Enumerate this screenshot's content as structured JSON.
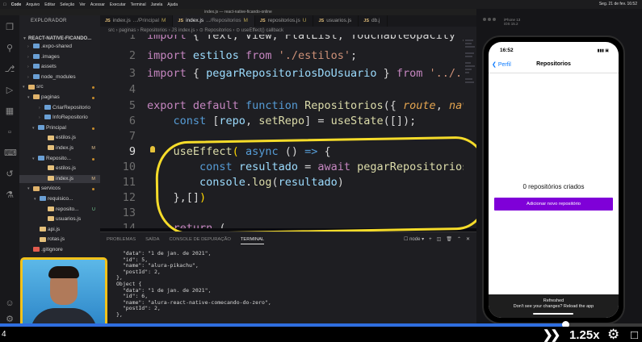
{
  "menubar": {
    "items": [
      "Code",
      "Arquivo",
      "Editar",
      "Seleção",
      "Ver",
      "Acessar",
      "Executar",
      "Terminal",
      "Janela",
      "Ajuda"
    ],
    "clock": "Seg. 21 de fev. 16:52"
  },
  "window_title": "index.js — react-native-ficando-online",
  "explorer": {
    "header": "EXPLORADOR",
    "project": "REACT-NATIVE-FICANDO...",
    "rows": [
      {
        "label": ".expo-shared",
        "badge": ""
      },
      {
        "label": ".images",
        "badge": ""
      },
      {
        "label": "assets",
        "badge": ""
      },
      {
        "label": "node_modules",
        "badge": ""
      },
      {
        "label": "src",
        "badge": ""
      },
      {
        "label": "paginas",
        "badge": ""
      },
      {
        "label": "CriarRepositorio",
        "badge": ""
      },
      {
        "label": "InfoRepositorio",
        "badge": ""
      },
      {
        "label": "Principal",
        "badge": ""
      },
      {
        "label": "estilos.js",
        "badge": ""
      },
      {
        "label": "index.js",
        "badge": "M"
      },
      {
        "label": "Reposito...",
        "badge": ""
      },
      {
        "label": "estilos.js",
        "badge": ""
      },
      {
        "label": "index.js",
        "badge": "M"
      },
      {
        "label": "servicos",
        "badge": ""
      },
      {
        "label": "requisico...",
        "badge": ""
      },
      {
        "label": "reposito...",
        "badge": "U"
      },
      {
        "label": "usuarios.js",
        "badge": ""
      },
      {
        "label": "api.js",
        "badge": ""
      },
      {
        "label": "rotas.js",
        "badge": ""
      },
      {
        "label": ".gitignore",
        "badge": ""
      }
    ]
  },
  "tabs": [
    {
      "label": "index.js",
      "hint": ".../Principal",
      "mod": "M",
      "active": false
    },
    {
      "label": "index.js",
      "hint": ".../Repositorios",
      "mod": "M",
      "active": true
    },
    {
      "label": "repositorios.js",
      "hint": "",
      "mod": "U",
      "active": false
    },
    {
      "label": "usuarios.js",
      "hint": "",
      "mod": "",
      "active": false
    },
    {
      "label": "db.j",
      "hint": "",
      "mod": "",
      "active": false
    }
  ],
  "breadcrumb": "src › paginas › Repositorios › JS index.js › ⊙ Repositorios › ⊙ useEffect() callback",
  "code": {
    "line_numbers": [
      "1",
      "2",
      "3",
      "4",
      "5",
      "6",
      "7",
      "8",
      "9",
      "10",
      "11",
      "12",
      "13",
      "14"
    ],
    "current_line": "9"
  },
  "panel": {
    "tabs": [
      "PROBLEMAS",
      "SAÍDA",
      "CONSOLE DE DEPURAÇÃO",
      "TERMINAL"
    ],
    "active_tab": "TERMINAL",
    "terminal_select": "node",
    "terminal_lines": [
      "  \"data\": \"1 de jan. de 2021\",",
      "  \"id\": 5,",
      "  \"name\": \"alura-pikachu\",",
      "  \"postId\": 2,",
      "},",
      "Object {",
      "  \"data\": \"1 de jan. de 2021\",",
      "  \"id\": 6,",
      "  \"name\": \"alura-react-native-comecando-do-zero\",",
      "  \"postId\": 2,",
      "},"
    ]
  },
  "simulator": {
    "device": "iPhone 13",
    "os": "iOS 15.2",
    "status_time": "16:52",
    "back_label": "Perfil",
    "screen_title": "Repositorios",
    "count_text": "0 repositórios criados",
    "add_button": "Adicionar novo repositório",
    "refresh_title": "Refreshed",
    "refresh_sub": "Don't see your changes? Reload the app",
    "accent": "#7f00d8"
  },
  "player": {
    "time": "4",
    "speed": "1.25x",
    "progress": 0.88,
    "forward_icon": "fast-forward-icon",
    "settings_icon": "gear-icon"
  }
}
